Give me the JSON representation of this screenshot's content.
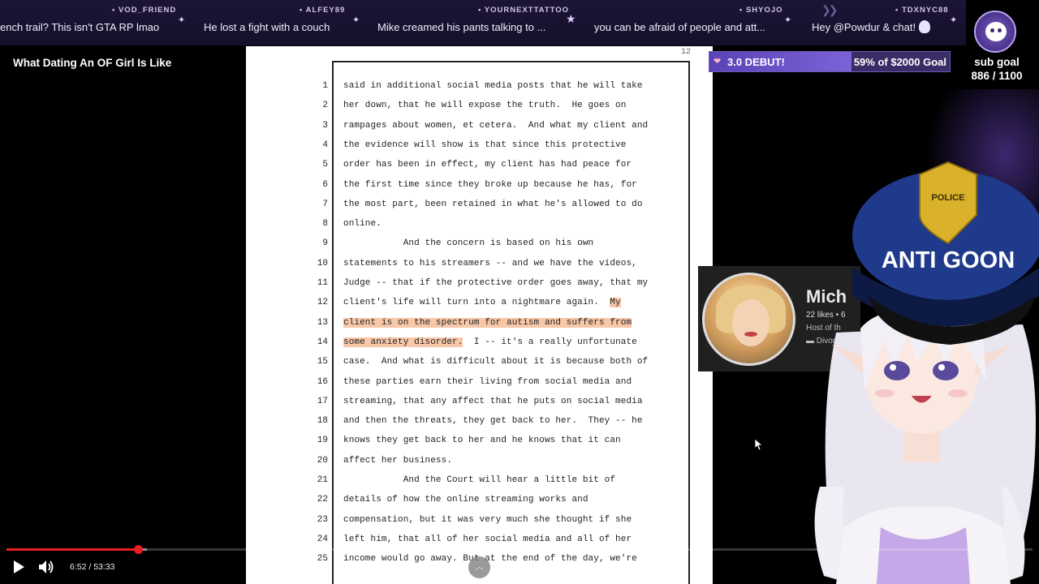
{
  "chat_ticker": {
    "items": [
      {
        "user": "",
        "message": "ench trail? This isn't GTA RP lmao"
      },
      {
        "user": "VOD_FRIEND",
        "message": "He lost a fight with a couch"
      },
      {
        "user": "ALFEY89",
        "message": "Mike creamed his pants talking to ..."
      },
      {
        "user": "YOURNEXTTATTOO",
        "message": "you can be afraid of people and att..."
      },
      {
        "user": "SHYOJO",
        "message": "Hey @Powdur & chat!"
      },
      {
        "user": "TDXNYC88",
        "message": ""
      }
    ]
  },
  "video": {
    "title": "What Dating An OF Girl Is Like",
    "current_time": "6:52",
    "duration": "53:33",
    "time_display": "6:52 / 53:33",
    "progress_fraction": 0.128
  },
  "document": {
    "page_number": "12",
    "lines": [
      {
        "num": "1",
        "text": "said in additional social media posts that he will take"
      },
      {
        "num": "2",
        "text": "her down, that he will expose the truth.  He goes on"
      },
      {
        "num": "3",
        "text": "rampages about women, et cetera.  And what my client and"
      },
      {
        "num": "4",
        "text": "the evidence will show is that since this protective"
      },
      {
        "num": "5",
        "text": "order has been in effect, my client has had peace for"
      },
      {
        "num": "6",
        "text": "the first time since they broke up because he has, for"
      },
      {
        "num": "7",
        "text": "the most part, been retained in what he's allowed to do"
      },
      {
        "num": "8",
        "text": "online."
      },
      {
        "num": "9",
        "text": "           And the concern is based on his own"
      },
      {
        "num": "10",
        "text": "statements to his streamers -- and we have the videos,"
      },
      {
        "num": "11",
        "text": "Judge -- that if the protective order goes away, that my"
      },
      {
        "num": "12",
        "text": "client's life will turn into a nightmare again.  ",
        "highlight": "My"
      },
      {
        "num": "13",
        "text": "",
        "highlight": "client is on the spectrum for autism and suffers from"
      },
      {
        "num": "14",
        "text": "  I -- it's a really unfortunate",
        "highlight_prefix": "some anxiety disorder."
      },
      {
        "num": "15",
        "text": "case.  And what is difficult about it is because both of"
      },
      {
        "num": "16",
        "text": "these parties earn their living from social media and"
      },
      {
        "num": "17",
        "text": "streaming, that any affect that he puts on social media"
      },
      {
        "num": "18",
        "text": "and then the threats, they get back to her.  They -- he"
      },
      {
        "num": "19",
        "text": "knows they get back to her and he knows that it can"
      },
      {
        "num": "20",
        "text": "affect her business."
      },
      {
        "num": "21",
        "text": "           And the Court will hear a little bit of"
      },
      {
        "num": "22",
        "text": "details of how the online streaming works and"
      },
      {
        "num": "23",
        "text": "compensation, but it was very much she thought if she"
      },
      {
        "num": "24",
        "text": "left him, that all of her social media and all of her"
      },
      {
        "num": "25",
        "text": "income would go away. But at the end of the day, we're"
      }
    ]
  },
  "goal_bar": {
    "title": "3.0 DEBUT!",
    "progress_text": "59% of $2000 Goal",
    "progress_fraction": 0.59
  },
  "sub_goal": {
    "label": "sub goal",
    "count": "886 / 1100"
  },
  "profile_card": {
    "name": "Mich",
    "likes": "22 likes • 6",
    "description": "Host of th",
    "category": "Divor"
  },
  "vtuber": {
    "hat_badge": "POLICE",
    "hat_text": "ANTI GOON"
  },
  "colors": {
    "ticker_bg": "#1c1436",
    "progress_red": "#e52020",
    "goal_fill": "#6a52c8",
    "highlight": "#f7c7a8"
  }
}
